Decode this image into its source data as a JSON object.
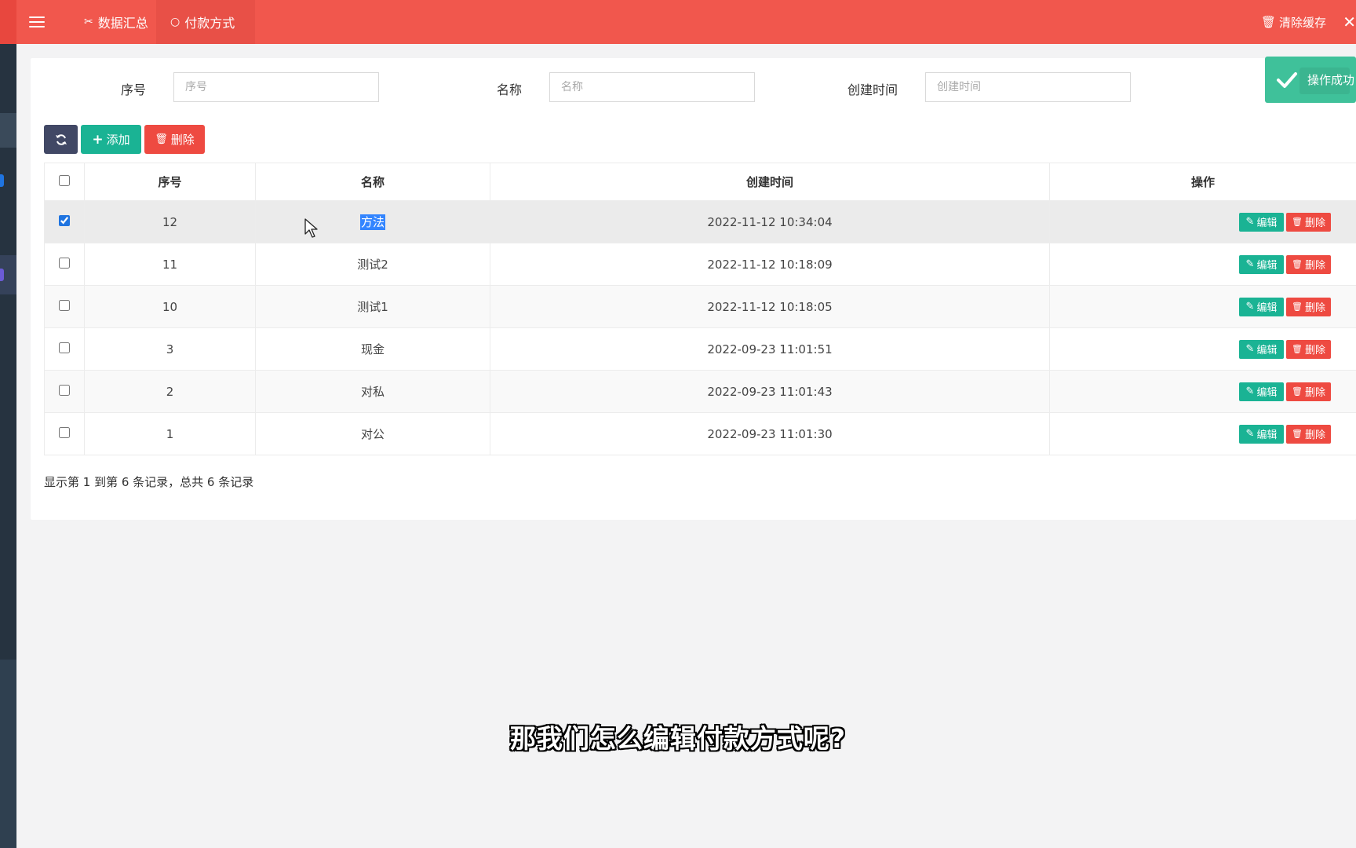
{
  "header": {
    "tabs": [
      {
        "label": "数据汇总",
        "icon": "scissors-icon"
      },
      {
        "label": "付款方式",
        "icon": "circle-icon"
      }
    ],
    "clear_cache": "清除缓存"
  },
  "search": {
    "fields": [
      {
        "label": "序号",
        "placeholder": "序号"
      },
      {
        "label": "名称",
        "placeholder": "名称"
      },
      {
        "label": "创建时间",
        "placeholder": "创建时间"
      }
    ]
  },
  "toast": {
    "text": "操作成功"
  },
  "toolbar": {
    "add_label": "添加",
    "delete_label": "删除"
  },
  "table": {
    "headers": [
      "序号",
      "名称",
      "创建时间",
      "操作"
    ],
    "edit_label": "编辑",
    "delete_label": "删除",
    "rows": [
      {
        "id": "12",
        "name": "方法",
        "created": "2022-11-12 10:34:04",
        "checked": true
      },
      {
        "id": "11",
        "name": "测试2",
        "created": "2022-11-12 10:18:09",
        "checked": false
      },
      {
        "id": "10",
        "name": "测试1",
        "created": "2022-11-12 10:18:05",
        "checked": false
      },
      {
        "id": "3",
        "name": "现金",
        "created": "2022-09-23 11:01:51",
        "checked": false
      },
      {
        "id": "2",
        "name": "对私",
        "created": "2022-09-23 11:01:43",
        "checked": false
      },
      {
        "id": "1",
        "name": "对公",
        "created": "2022-09-23 11:01:30",
        "checked": false
      }
    ]
  },
  "pagination": {
    "info": "显示第 1 到第 6 条记录，总共 6 条记录"
  },
  "subtitle": "那我们怎么编辑付款方式呢?",
  "colors": {
    "header": "#f1574d",
    "primary": "#1ab394",
    "danger": "#ee4a41",
    "sidebar": "#2f4050"
  }
}
